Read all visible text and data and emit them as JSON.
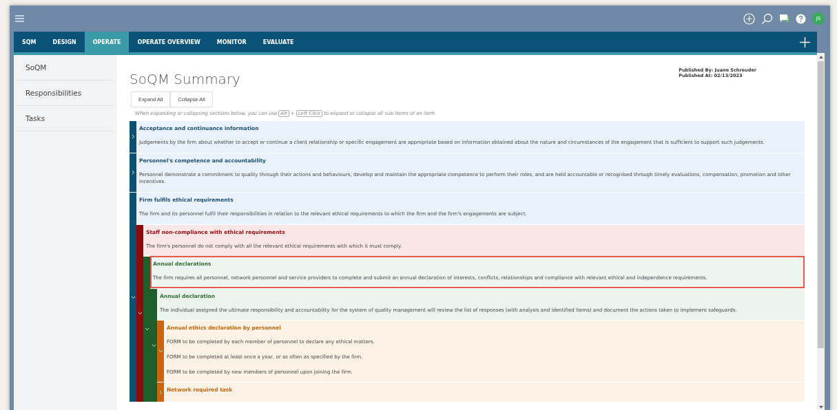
{
  "top_bar": {
    "avatar": "JS"
  },
  "tabs": [
    {
      "label": "SQM",
      "selected": false
    },
    {
      "label": "DESIGN",
      "selected": false
    },
    {
      "label": "OPERATE",
      "selected": true
    },
    {
      "label": "OPERATE OVERVIEW",
      "selected": false
    },
    {
      "label": "MONITOR",
      "selected": false
    },
    {
      "label": "EVALUATE",
      "selected": false
    }
  ],
  "sidebar": {
    "items": [
      {
        "label": "SoQM",
        "selected": false
      },
      {
        "label": "Responsibilities",
        "selected": false
      },
      {
        "label": "Tasks",
        "selected": false
      }
    ]
  },
  "page": {
    "title": "SoQM Summary",
    "published_by": "Published By: Juane Schreuder",
    "published_at": "Published At: 02/13/2023",
    "buttons": [
      "Expand All",
      "Collapse All"
    ],
    "hint": {
      "before": "When expanding or collapsing sections below, you can use",
      "keys": [
        "Alt",
        "Left Click"
      ],
      "joiner": "+",
      "after": "to expand or collapse all sub-items of an item."
    }
  },
  "tree": [
    {
      "kind": "category",
      "title": "Acceptance and continuance information",
      "text": [
        "Judgements by the firm about whether to accept or continue a client relationship or specific engagement are appropriate based on information obtained about the nature and circumstances of the engagement that is sufficient to support such judgements."
      ],
      "expanded": false,
      "selected": false
    },
    {
      "kind": "category",
      "title": "Personnel's competence and accountability",
      "text": [
        "Personnel demonstrate a commitment to quality through their actions and behaviours, develop and maintain the appropriate competence to perform their roles, and are held accountable or recognised through timely evaluations, compensation, promotion and other incentives."
      ],
      "expanded": false,
      "selected": false
    },
    {
      "kind": "category",
      "title": "Firm fulfils ethical requirements",
      "text": [
        "The firm and its personnel fulfil their responsibilities in relation to the relevant ethical requirements to which the firm and the firm's engagements are subject."
      ],
      "expanded": true,
      "selected": false,
      "children": [
        {
          "kind": "risk",
          "title": "Staff non-compliance with ethical requirements",
          "text": [
            "The firm's personnel do not comply with all the relevant ethical requirements with which it must comply."
          ],
          "expanded": true,
          "selected": false,
          "children": [
            {
              "kind": "response",
              "title": "Annual declarations",
              "text": [
                "The firm requires all personnel, network personnel and service providers to complete and submit an annual declaration of interests, conflicts, relationships and compliance with relevant ethical and independence requirements."
              ],
              "expanded": true,
              "selected": true,
              "children": [
                {
                  "kind": "response",
                  "title": "Annual declaration",
                  "text": [
                    "The individual assigned the ultimate responsibility and accountability for the system of quality management will review the list of responses (with analysis and identified items) and document the actions taken to implement safeguards."
                  ],
                  "expanded": true,
                  "selected": false,
                  "children": [
                    {
                      "kind": "task",
                      "title": "Annual ethics declaration by personnel",
                      "text": [
                        "FORM to be completed by each member of personnel to declare any ethical matters.",
                        "FORM to be completed at least once a year, or as often as specified by the firm.",
                        "FORM to be completed by new members of personnel upon joining the firm."
                      ],
                      "expanded": true,
                      "selected": false
                    },
                    {
                      "kind": "task",
                      "title": "Network required task",
                      "expanded": false,
                      "selected": false
                    }
                  ]
                }
              ]
            }
          ]
        }
      ]
    }
  ]
}
